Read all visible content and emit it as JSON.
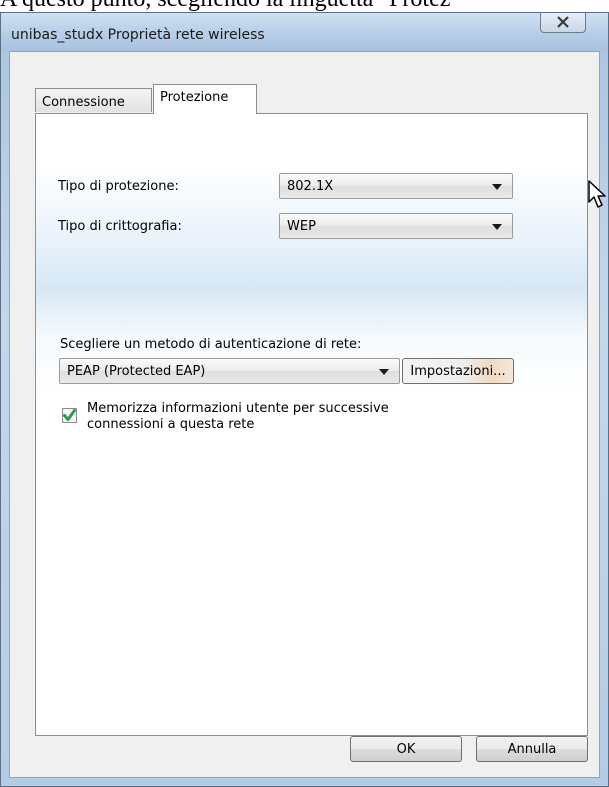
{
  "background_text": "A questo punto, scegliendo la linguetta \"Protez",
  "window": {
    "title": "unibas_studx Proprietà rete wireless",
    "close_icon": "close-icon"
  },
  "tabs": [
    {
      "label": "Connessione",
      "selected": false
    },
    {
      "label": "Protezione",
      "selected": true
    }
  ],
  "security": {
    "type_label": "Tipo di protezione:",
    "type_value": "802.1X",
    "encryption_label": "Tipo di crittografia:",
    "encryption_value": "WEP"
  },
  "auth": {
    "label": "Scegliere un metodo di autenticazione di rete:",
    "method_value": "PEAP (Protected EAP)",
    "settings_label": "Impostazioni..."
  },
  "remember": {
    "checked": true,
    "line1": "Memorizza informazioni utente per successive",
    "line2": "connessioni a questa rete"
  },
  "footer": {
    "ok_label": "OK",
    "cancel_label": "Annulla"
  },
  "colors": {
    "checkmark": "#2e9a4b",
    "titlebar": "#b7cee8"
  }
}
